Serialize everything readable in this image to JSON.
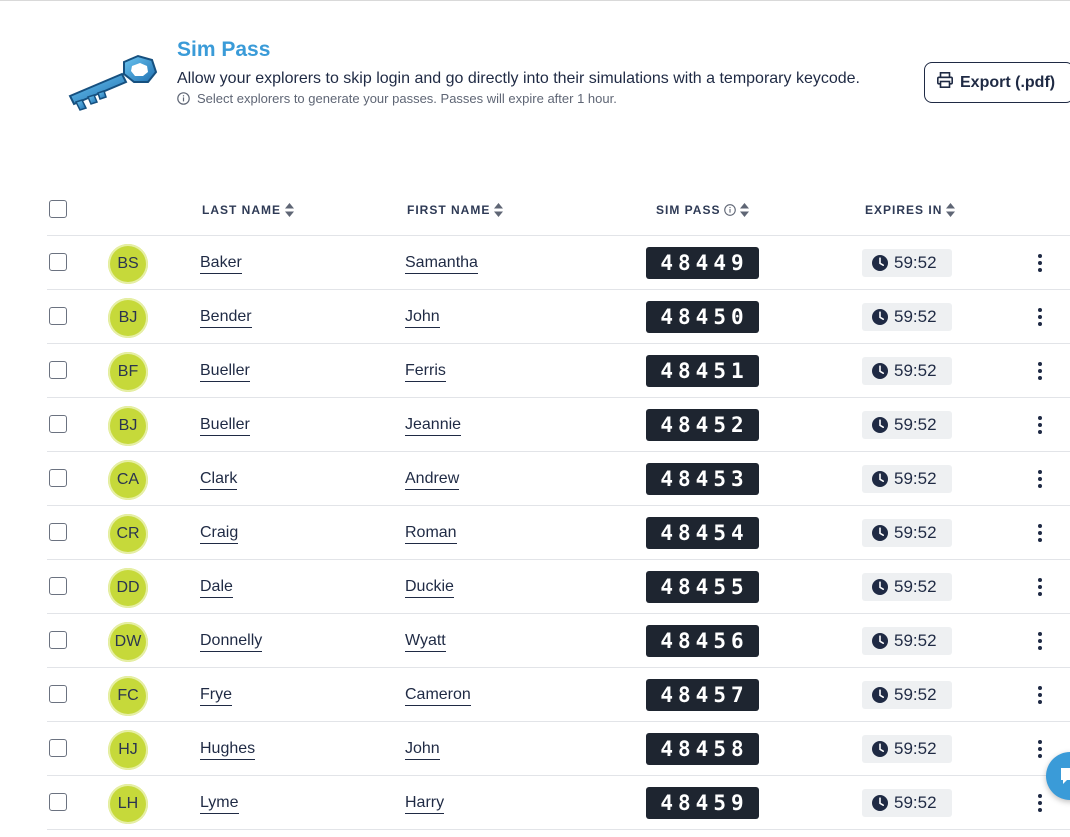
{
  "header": {
    "title": "Sim Pass",
    "subtitle": "Allow your explorers to skip login and go directly into their simulations with a temporary keycode.",
    "hint": "Select explorers to generate your passes. Passes will expire after 1 hour.",
    "export_label": "Export (.pdf)"
  },
  "columns": {
    "last_name": "LAST NAME",
    "first_name": "FIRST NAME",
    "sim_pass": "SIM PASS",
    "expires_in": "EXPIRES IN"
  },
  "rows": [
    {
      "initials": "BS",
      "last": "Baker",
      "first": "Samantha",
      "pass": "48449",
      "expires": "59:52"
    },
    {
      "initials": "BJ",
      "last": "Bender",
      "first": "John",
      "pass": "48450",
      "expires": "59:52"
    },
    {
      "initials": "BF",
      "last": "Bueller",
      "first": "Ferris",
      "pass": "48451",
      "expires": "59:52"
    },
    {
      "initials": "BJ",
      "last": "Bueller",
      "first": "Jeannie",
      "pass": "48452",
      "expires": "59:52"
    },
    {
      "initials": "CA",
      "last": "Clark",
      "first": "Andrew",
      "pass": "48453",
      "expires": "59:52"
    },
    {
      "initials": "CR",
      "last": "Craig",
      "first": "Roman",
      "pass": "48454",
      "expires": "59:52"
    },
    {
      "initials": "DD",
      "last": "Dale",
      "first": "Duckie",
      "pass": "48455",
      "expires": "59:52"
    },
    {
      "initials": "DW",
      "last": "Donnelly",
      "first": "Wyatt",
      "pass": "48456",
      "expires": "59:52"
    },
    {
      "initials": "FC",
      "last": "Frye",
      "first": "Cameron",
      "pass": "48457",
      "expires": "59:52"
    },
    {
      "initials": "HJ",
      "last": "Hughes",
      "first": "John",
      "pass": "48458",
      "expires": "59:52"
    },
    {
      "initials": "LH",
      "last": "Lyme",
      "first": "Harry",
      "pass": "48459",
      "expires": "59:52"
    }
  ],
  "colors": {
    "title_blue": "#3a9bd8",
    "avatar_green": "#c6d93a",
    "pass_bg": "#1e2530",
    "text_navy": "#1f2a44"
  }
}
